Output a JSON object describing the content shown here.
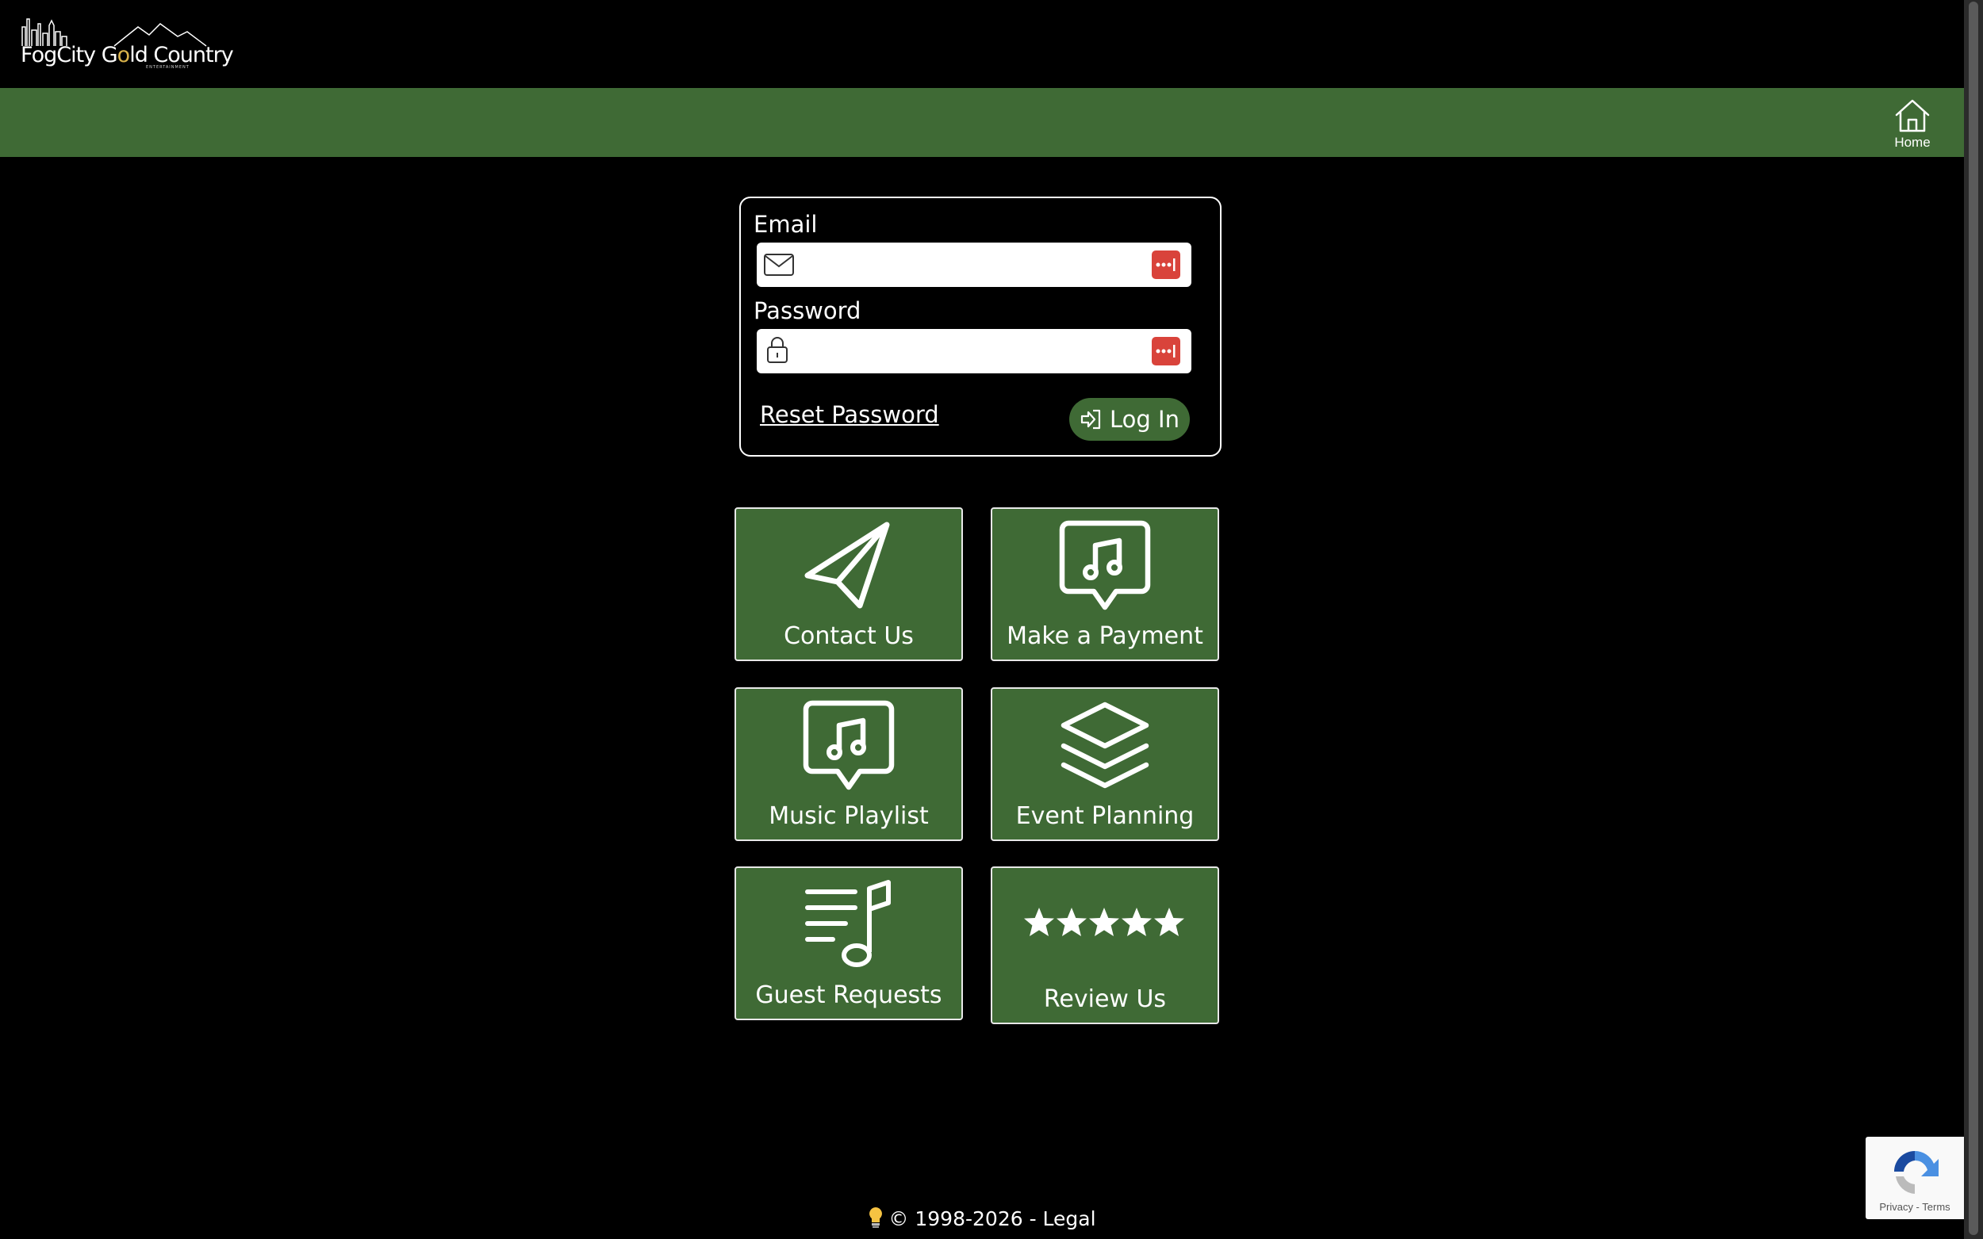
{
  "header": {
    "logo_text_part1": "FogCity G",
    "logo_text_gold": "o",
    "logo_text_part2": "ld Country",
    "logo_subtext": "ENTERTAINMENT"
  },
  "navbar": {
    "home_label": "Home"
  },
  "login": {
    "email_label": "Email",
    "email_value": "",
    "password_label": "Password",
    "password_value": "",
    "reset_label": "Reset Password",
    "login_label": "Log In"
  },
  "tiles": [
    {
      "label": "Contact Us",
      "icon": "paper-plane-icon"
    },
    {
      "label": "Make a Payment",
      "icon": "music-chat-icon"
    },
    {
      "label": "Music Playlist",
      "icon": "music-chat-icon"
    },
    {
      "label": "Event Planning",
      "icon": "layers-icon"
    },
    {
      "label": "Guest Requests",
      "icon": "playlist-note-icon"
    },
    {
      "label": "Review Us",
      "icon": "five-stars-icon"
    }
  ],
  "footer": {
    "copyright": "© 1998-2026 - Legal"
  },
  "recaptcha": {
    "links": "Privacy - Terms"
  },
  "colors": {
    "accent_green": "#3f6a35",
    "password_badge_red": "#d9433b",
    "background": "#000000"
  }
}
